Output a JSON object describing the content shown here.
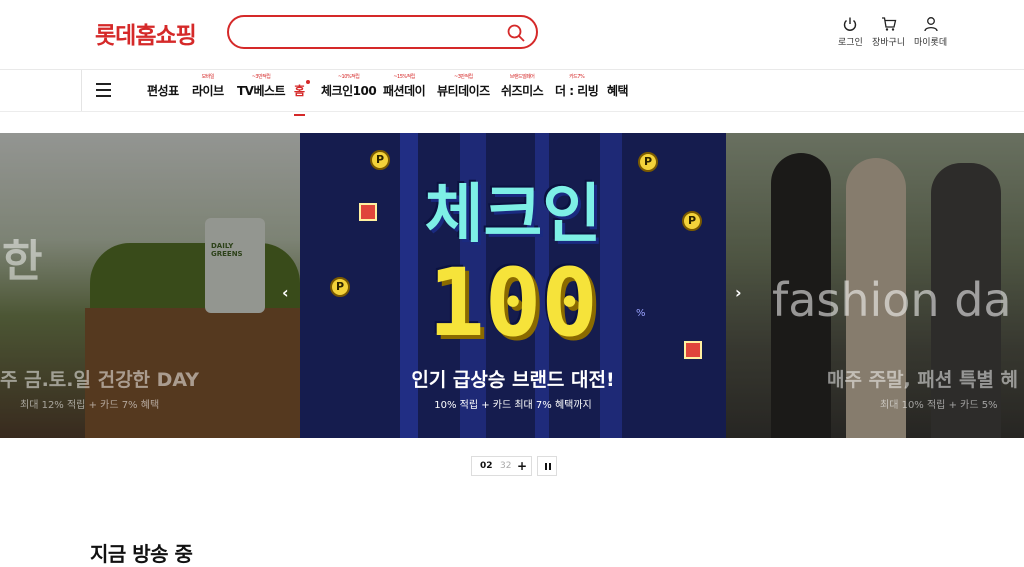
{
  "header": {
    "logo": "롯데홈쇼핑",
    "search_placeholder": "",
    "utils": [
      {
        "label": "로그인",
        "icon": "power-icon"
      },
      {
        "label": "장바구니",
        "icon": "cart-icon"
      },
      {
        "label": "마이롯데",
        "icon": "user-icon"
      }
    ]
  },
  "nav": {
    "items": [
      {
        "label": "편성표",
        "sup": ""
      },
      {
        "label": "라이브",
        "sup": "모바일"
      },
      {
        "label": "TV베스트",
        "sup": "~3만적립"
      },
      {
        "label": "홈",
        "sup": ""
      },
      {
        "label": "체크인100",
        "sup": "~10%적립"
      },
      {
        "label": "패션데이",
        "sup": "~15%적립"
      },
      {
        "label": "뷰티데이즈",
        "sup": "~3만적립"
      },
      {
        "label": "쉬즈미스",
        "sup": "브랜드빌페어"
      },
      {
        "label": "더 : 리빙",
        "sup": "카드7%"
      },
      {
        "label": "혜택",
        "sup": ""
      }
    ]
  },
  "banner": {
    "left": {
      "ghost_big": "한",
      "ghost_line": "주 금.토.일 건강한 DAY",
      "sub": "최대 12% 적립 + 카드 7% 혜택",
      "product": "DAILY GREENS"
    },
    "center": {
      "title_1": "체크인",
      "title_2": "100",
      "headline": "인기 급상승 브랜드 대전!",
      "sub": "10% 적립 + 카드 최대 7% 혜택까지",
      "coin_letter": "P",
      "percent": "%"
    },
    "right": {
      "ghost_big": "fashion da",
      "ghost_line": "매주 주말, 패션 특별 혜",
      "sub": "최대 10% 적립 + 카드 5%"
    },
    "prev_label": "‹",
    "next_label": "›"
  },
  "pager": {
    "current": "02",
    "total": "32",
    "plus": "+"
  },
  "section": {
    "title": "지금 방송 중"
  },
  "colors": {
    "brand": "#d52929",
    "banner_bg": "#151c4e",
    "title_cyan": "#7ef0e6",
    "title_yellow": "#f6e33a"
  }
}
